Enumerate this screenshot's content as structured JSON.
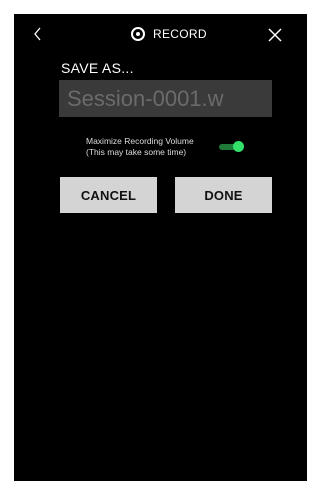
{
  "header": {
    "title": "RECORD",
    "back_icon": "chevron-left-icon",
    "close_icon": "close-icon",
    "record_icon": "record-icon"
  },
  "save_dialog": {
    "label": "SAVE AS...",
    "filename_value": "Session-0001.w",
    "maximize_line1": "Maximize Recording Volume",
    "maximize_line2": "(This may take some time)",
    "maximize_enabled": true,
    "cancel_label": "CANCEL",
    "done_label": "DONE"
  },
  "colors": {
    "background": "#000000",
    "toggle_on": "#33e06a",
    "button_bg": "#d4d4d4",
    "input_bg": "#3a3a3a"
  }
}
